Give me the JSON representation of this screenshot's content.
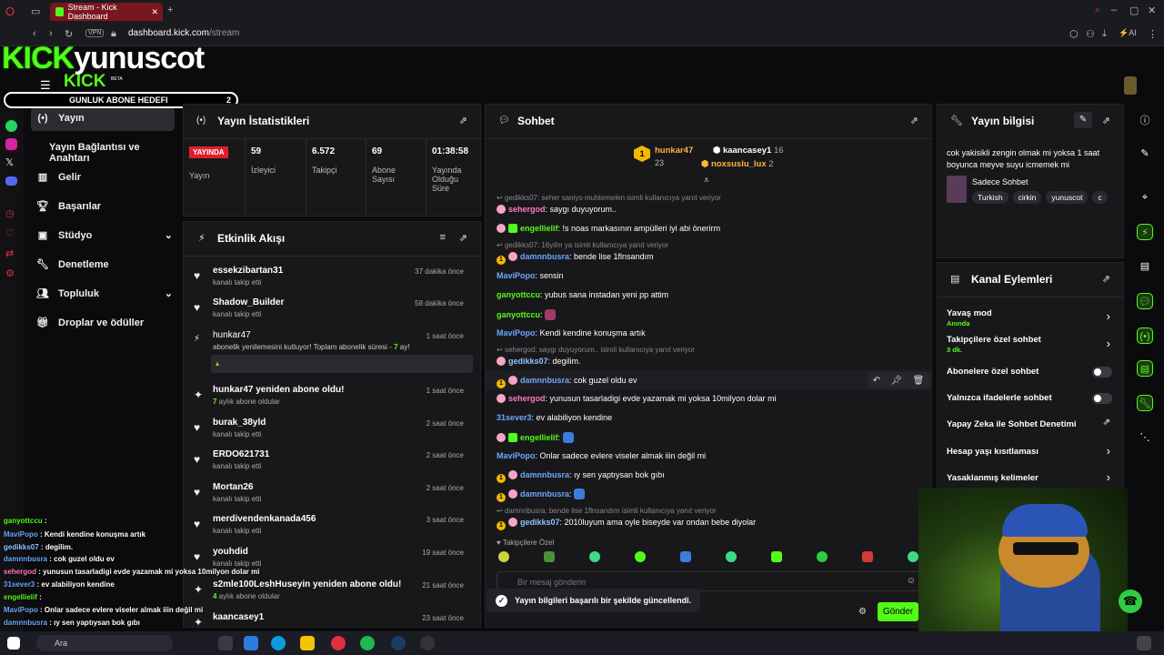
{
  "browser": {
    "tab_title": "Stream - Kick Dashboard",
    "url_host": "dashboard.kick.com",
    "url_path": "/stream",
    "vpn": "VPN",
    "ai": "AI"
  },
  "overlay": {
    "logo_kick": "KICK",
    "logo_name": "yunuscot",
    "logo_small": "KICK",
    "beta": "BETA",
    "abone_label": "GUNLUK ABONE HEDEFI",
    "abone_count": "2"
  },
  "sidebar": {
    "items": [
      {
        "label": "Yayın",
        "icon": "broadcast-icon"
      },
      {
        "label": "Yayın Bağlantısı ve Anahtarı",
        "icon": ""
      },
      {
        "label": "Gelir",
        "icon": "chart-icon"
      },
      {
        "label": "Başarılar",
        "icon": "trophy-icon"
      },
      {
        "label": "Stüdyo",
        "icon": "studio-icon"
      },
      {
        "label": "Denetleme",
        "icon": "wrench-icon"
      },
      {
        "label": "Topluluk",
        "icon": "users-icon"
      },
      {
        "label": "Droplar ve ödüller",
        "icon": "gift-icon"
      }
    ]
  },
  "stats": {
    "title": "Yayın İstatistikleri",
    "live_badge": "YAYINDA",
    "live_label": "Yayın",
    "cells": [
      {
        "value": "59",
        "label": "İzleyici"
      },
      {
        "value": "6.572",
        "label": "Takipçi"
      },
      {
        "value": "69",
        "label": "Abone Sayısı"
      },
      {
        "value": "01:38:58",
        "label": "Yayında Olduğu Süre"
      }
    ]
  },
  "activity": {
    "title": "Etkinlik Akışı",
    "events": [
      {
        "name": "essekzibartan31",
        "sub": "kanalı takip etti",
        "time": "37 dakika önce",
        "icon": "heart-icon"
      },
      {
        "name": "Shadow_Builder",
        "sub": "kanalı takip etti",
        "time": "58 dakika önce",
        "icon": "heart-icon"
      },
      {
        "name": "hunkar47",
        "sub": "abonelik yenilemesini kutluyor! Toplam abonelik süresi - ",
        "sub_b": "7",
        "sub_tail": " ay!",
        "time": "1 saat önce",
        "icon": "sparkle-icon"
      },
      {
        "name": "hunkar47 yeniden abone oldu!",
        "sub_b": "7",
        "sub": " aylık abone oldular",
        "time": "1 saat önce",
        "icon": "sparkle-icon"
      },
      {
        "name": "burak_38yld",
        "sub": "kanalı takip etti",
        "time": "2 saat önce",
        "icon": "heart-icon"
      },
      {
        "name": "ERDO621731",
        "sub": "kanalı takip etti",
        "time": "2 saat önce",
        "icon": "heart-icon"
      },
      {
        "name": "Mortan26",
        "sub": "kanalı takip etti",
        "time": "2 saat önce",
        "icon": "heart-icon"
      },
      {
        "name": "merdivendenkanada456",
        "sub": "kanalı takip etti",
        "time": "3 saat önce",
        "icon": "heart-icon"
      },
      {
        "name": "youhdid",
        "sub": "kanalı takip etti",
        "time": "19 saat önce",
        "icon": "heart-icon"
      },
      {
        "name": "s2mle100LeshHuseyin yeniden abone oldu!",
        "sub_b": "4",
        "sub": " aylık abone oldular",
        "time": "21 saat önce",
        "icon": "sparkle-icon"
      },
      {
        "name": "kaancasey1",
        "sub": "",
        "time": "23 saat önce",
        "icon": "sparkle-icon"
      }
    ]
  },
  "chat": {
    "title": "Sohbet",
    "leaders": {
      "first_name": "hunkar47",
      "first_rank": "1",
      "first_count": "23",
      "second_name": "kaancasey1",
      "second_count": "16",
      "third_name": "noxsuslu_lux",
      "third_count": "2"
    },
    "messages": [
      {
        "reply": "gedikks07: seher saniyo muhtemelen isimli kullanıcıya yanıt veriyor"
      },
      {
        "user": "sehergod",
        "text": ": saygı duyuyorum..",
        "color": "pink"
      },
      {
        "user": "engellielif",
        "text": ": !s noas markasının ampülleri iyi abi önerirm",
        "color": "green"
      },
      {
        "reply": "gedikks07: 16yilm ya isimli kullanıcıya yanıt veriyor"
      },
      {
        "user": "damnnbusra",
        "text": ": bende lise 1flnsandım",
        "color": "blue"
      },
      {
        "user": "MaviPopo",
        "text": ": sensin",
        "color": "blue"
      },
      {
        "user": "ganyottccu",
        "text": ": yubus sana instadan yeni pp attim",
        "color": "green"
      },
      {
        "user": "ganyottccu",
        "text": ":",
        "color": "green"
      },
      {
        "user": "MaviPopo",
        "text": ": Kendi kendine konuşma artık",
        "color": "blue"
      },
      {
        "reply": "sehergod: saygı duyuyorum.. isimli kullanıcıya yanıt veriyor"
      },
      {
        "user": "gedikks07",
        "text": ": degilim.",
        "color": "lblue"
      },
      {
        "user": "damnnbusra",
        "text": ": cok guzel oldu ev",
        "color": "blue"
      },
      {
        "user": "sehergod",
        "text": ": yunusun tasarladigi evde yazamak mi yoksa 10milyon dolar mi",
        "color": "pink"
      },
      {
        "user": "31sever3",
        "text": ": ev alabiliyon kendine",
        "color": "blue"
      },
      {
        "user": "engellielif",
        "text": ":",
        "color": "green"
      },
      {
        "user": "MaviPopo",
        "text": ": Onlar sadece evlere viseler almak iiin değil mi",
        "color": "blue"
      },
      {
        "user": "damnnbusra",
        "text": ": ıy sen yaptıysan bok gıbı",
        "color": "blue"
      },
      {
        "user": "damnnbusra",
        "text": ":",
        "color": "blue"
      },
      {
        "reply": "damnnbusra: bende lise 1flnsandım isimli kullanıcıya yanıt veriyor"
      },
      {
        "user": "gedikks07",
        "text": ": 2010luyum ama oyle biseyde var ondan bebe diyolar",
        "color": "lblue"
      }
    ],
    "followers_only": "Takipçilere Özel",
    "input_placeholder": "Bir mesaj gönderin",
    "send_label": "Gönder"
  },
  "stream_info": {
    "title": "Yayın bilgisi",
    "stream_title": "cok yakisikli zengin olmak mi yoksa 1 saat boyunca meyve suyu icmemek mi",
    "category": "Sadece Sohbet",
    "tags": [
      "Turkish",
      "cirkin",
      "yunuscot",
      "c"
    ]
  },
  "channel_actions": {
    "title": "Kanal Eylemleri",
    "items": [
      {
        "label": "Yavaş mod",
        "sub": "Anında",
        "control": "chevron"
      },
      {
        "label": "Takipçilere özel sohbet",
        "sub": "3 dk.",
        "control": "chevron"
      },
      {
        "label": "Abonelere özel sohbet",
        "sub": "",
        "control": "toggle"
      },
      {
        "label": "Yalnızca ifadelerle sohbet",
        "sub": "",
        "control": "toggle"
      },
      {
        "label": "Yapay Zeka ile Sohbet Denetimi",
        "sub": "",
        "control": "external"
      },
      {
        "label": "Hesap yaşı kısıtlaması",
        "sub": "",
        "control": "chevron"
      },
      {
        "label": "Yasaklanmış kelimeler",
        "sub": "",
        "control": "chevron"
      }
    ]
  },
  "toast": {
    "text": "Yayın bilgileri başarılı bir şekilde güncellendi."
  },
  "overlay_chat": [
    {
      "u": "ganyottccu",
      "t": " :"
    },
    {
      "u": "MaviPopo",
      "t": " : Kendi kendine konuşma artık"
    },
    {
      "u": "gedikks07",
      "t": " : degilim."
    },
    {
      "u": "damnnbusra",
      "t": " : cok guzel oldu ev"
    },
    {
      "u": "sehergod",
      "t": " : yunusun tasarladigi evde yazamak mi yoksa 10milyon dolar mi"
    },
    {
      "u": "31sever3",
      "t": " : ev alabiliyon kendine"
    },
    {
      "u": "engellielif",
      "t": " :"
    },
    {
      "u": "MaviPopo",
      "t": " : Onlar sadece evlere viseler almak iiin değil mi"
    },
    {
      "u": "damnnbusra",
      "t": " : ıy sen yaptıysan bok gıbı"
    },
    {
      "u": "damnnbusra",
      "t": " :"
    }
  ],
  "taskbar": {
    "search": "Ara"
  },
  "colors": {
    "accent": "#53fc18",
    "panel": "#18181b",
    "bg": "#0b0b0d",
    "tab": "#7a1620"
  }
}
